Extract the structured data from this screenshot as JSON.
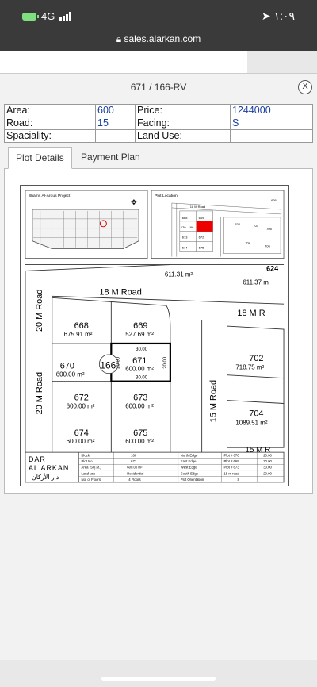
{
  "status": {
    "network": "4G",
    "time": "١:٠٩"
  },
  "browser": {
    "url": "sales.alarkan.com"
  },
  "modal": {
    "title": "671 / 166-RV",
    "close": "X"
  },
  "info": {
    "area_label": "Area:",
    "area_value": "600",
    "price_label": "Price:",
    "price_value": "1244000",
    "road_label": "Road:",
    "road_value": "15",
    "facing_label": "Facing:",
    "facing_value": "S",
    "speciality_label": "Spaciality:",
    "speciality_value": "",
    "landuse_label": "Land Use:",
    "landuse_value": ""
  },
  "tabs": [
    {
      "label": "Plot Details"
    },
    {
      "label": "Payment Plan"
    }
  ],
  "plan": {
    "project": "Shams Al-Arous Project",
    "location_label": "Plot Location",
    "roads": {
      "north": "18 M Road",
      "west": "20 M Road",
      "west2": "20 M Road",
      "east": "15 M Road",
      "east_top": "18 M R",
      "south": "15 M R"
    },
    "plots": [
      {
        "no": "668",
        "area": "675.91 m²"
      },
      {
        "no": "669",
        "area": "527.69 m²"
      },
      {
        "no": "670",
        "area": "600.00 m²"
      },
      {
        "no": "671",
        "area": "600.00 m²"
      },
      {
        "no": "672",
        "area": "600.00 m²"
      },
      {
        "no": "673",
        "area": "600.00 m²"
      },
      {
        "no": "674",
        "area": "600.00 m²"
      },
      {
        "no": "675",
        "area": "600.00 m²"
      },
      {
        "no": "702",
        "area": "718.75 m²"
      },
      {
        "no": "704",
        "area": "1089.51 m²"
      }
    ],
    "block": "166",
    "dims": {
      "top": "30.00",
      "bottom": "30.00",
      "left": "20.00",
      "right": "20.00"
    },
    "top_strip": {
      "a": "611.31 m²",
      "b": "611.37 m",
      "c": "624"
    },
    "company": {
      "line1": "DAR",
      "line2": "AL ARKAN",
      "arabic": "دار الأركان"
    },
    "legend": [
      {
        "k": "Block",
        "v": "166",
        "k2": "North Edge",
        "v2": "Plot # 670",
        "v3": "20.00"
      },
      {
        "k": "Plot No.",
        "v": "671",
        "k2": "East Edge",
        "v2": "Plot # 669",
        "v3": "30.00"
      },
      {
        "k": "Area (SQ.M.)",
        "v": "600.00 m²",
        "k2": "West Edge",
        "v2": "Plot # 673",
        "v3": "30.00"
      },
      {
        "k": "Land-use",
        "v": "Residential",
        "k2": "South Edge",
        "v2": "15 m road",
        "v3": "20.00"
      },
      {
        "k": "No. of Floors",
        "v": "4 Floors",
        "k2": "Plot Orientation",
        "v2": "S",
        "v3": ""
      }
    ],
    "mini_plots": [
      "668",
      "669",
      "670",
      "166",
      "671",
      "672",
      "673",
      "674",
      "675",
      "702",
      "703",
      "705",
      "704",
      "706",
      "626"
    ]
  }
}
